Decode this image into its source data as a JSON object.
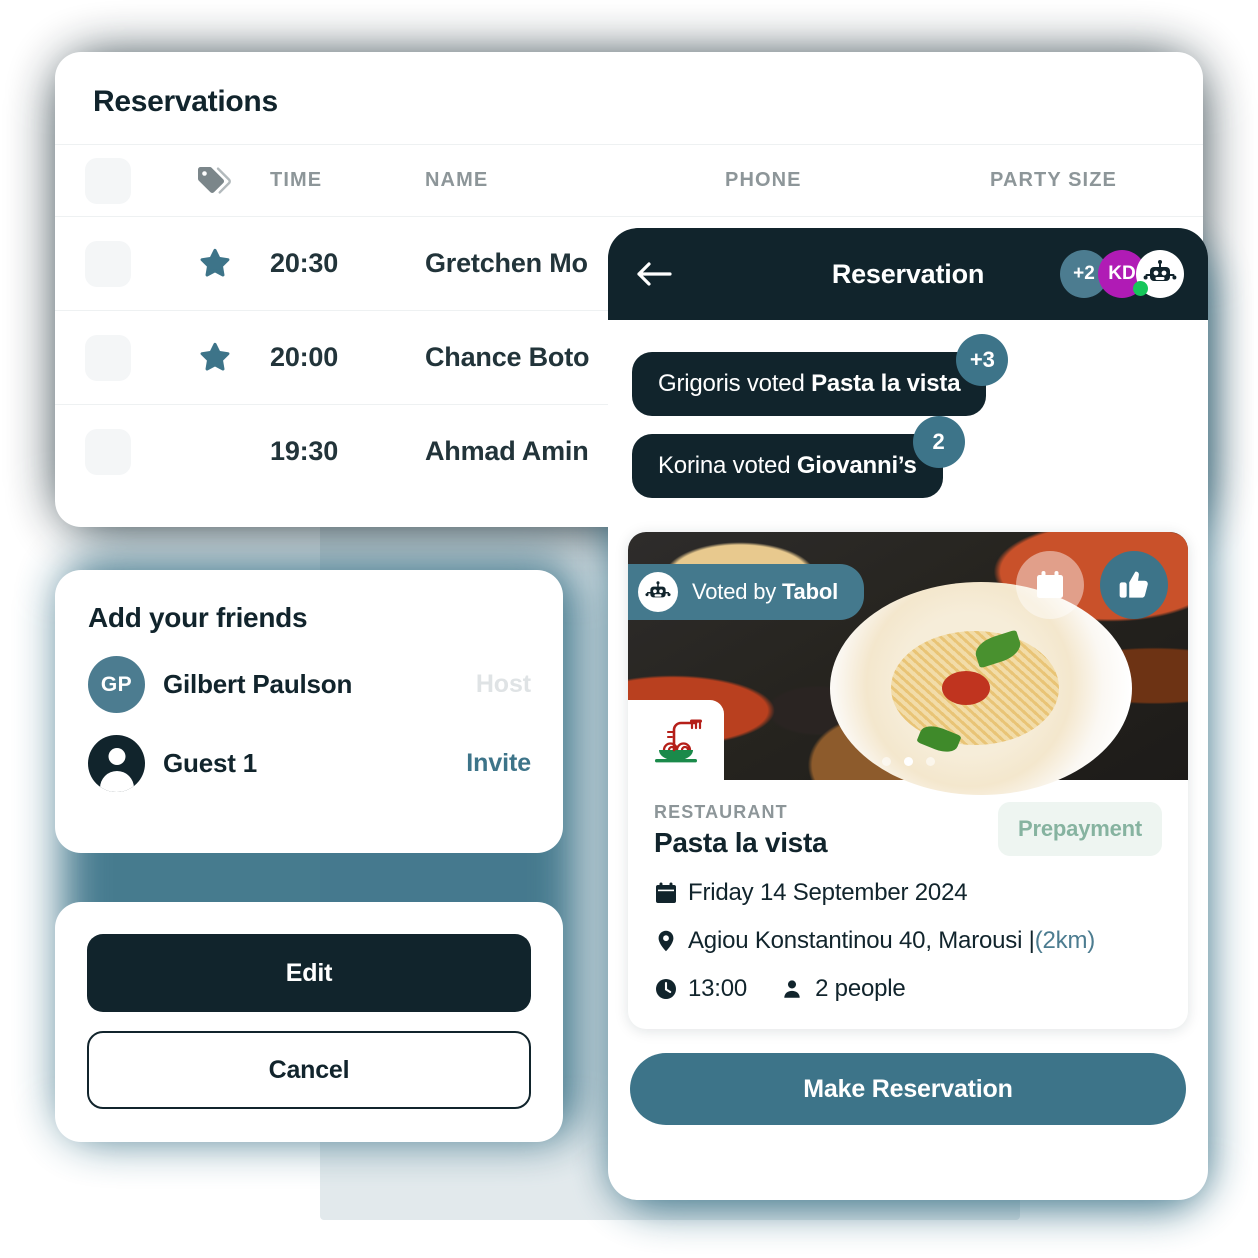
{
  "reservations_panel": {
    "title": "Reservations",
    "columns": [
      "",
      "tag-icon",
      "TIME",
      "NAME",
      "PHONE",
      "PARTY SIZE"
    ],
    "column_labels": {
      "time": "TIME",
      "name": "NAME",
      "phone": "PHONE",
      "party_size": "PARTY SIZE"
    },
    "rows": [
      {
        "starred": true,
        "time": "20:30",
        "name": "Gretchen Mo"
      },
      {
        "starred": true,
        "time": "20:00",
        "name": "Chance Boto"
      },
      {
        "starred": false,
        "time": "19:30",
        "name": "Ahmad Amin"
      }
    ]
  },
  "friends_card": {
    "title": "Add your friends",
    "people": [
      {
        "initials": "GP",
        "name": "Gilbert Paulson",
        "action": "Host",
        "action_kind": "host"
      },
      {
        "initials": "",
        "name": "Guest 1",
        "action": "Invite",
        "action_kind": "invite"
      }
    ]
  },
  "actions_card": {
    "edit_label": "Edit",
    "cancel_label": "Cancel"
  },
  "phone": {
    "header": {
      "title": "Reservation",
      "back_icon": "arrow-left-icon",
      "avatars": [
        {
          "type": "count",
          "label": "+2",
          "color": "#4c7c90"
        },
        {
          "type": "initials",
          "label": "KD",
          "color": "#b01bb5"
        },
        {
          "type": "bot",
          "label": "",
          "color": "#ffffff",
          "online": true
        }
      ]
    },
    "votes": [
      {
        "text_before": "Grigoris voted ",
        "restaurant": "Pasta la vista",
        "badge": "+3"
      },
      {
        "text_before": "Korina voted ",
        "restaurant": "Giovanni’s",
        "badge": "2"
      }
    ],
    "restaurant_card": {
      "voted_by_prefix": "Voted by ",
      "voted_by_name": "Tabol",
      "photo_actions": [
        "calendar-icon",
        "thumbs-up-icon"
      ],
      "carousel_dots": 3,
      "carousel_active_index": 1,
      "kicker": "RESTAURANT",
      "name": "Pasta la vista",
      "badge": "Prepayment",
      "date": "Friday 14 September 2024",
      "address": "Agiou Konstantinou 40, Marousi | ",
      "distance": "(2km)",
      "time": "13:00",
      "party": "2 people"
    },
    "cta_label": "Make Reservation"
  },
  "colors": {
    "dark": "#11242c",
    "teal": "#3d7489",
    "teal_light": "#4c7c90",
    "magenta": "#b01bb5",
    "green_dot": "#16c65a",
    "prepay_text": "#86b3a0",
    "prepay_bg": "#eef5f1",
    "backdrop": "#e2e9ec"
  }
}
